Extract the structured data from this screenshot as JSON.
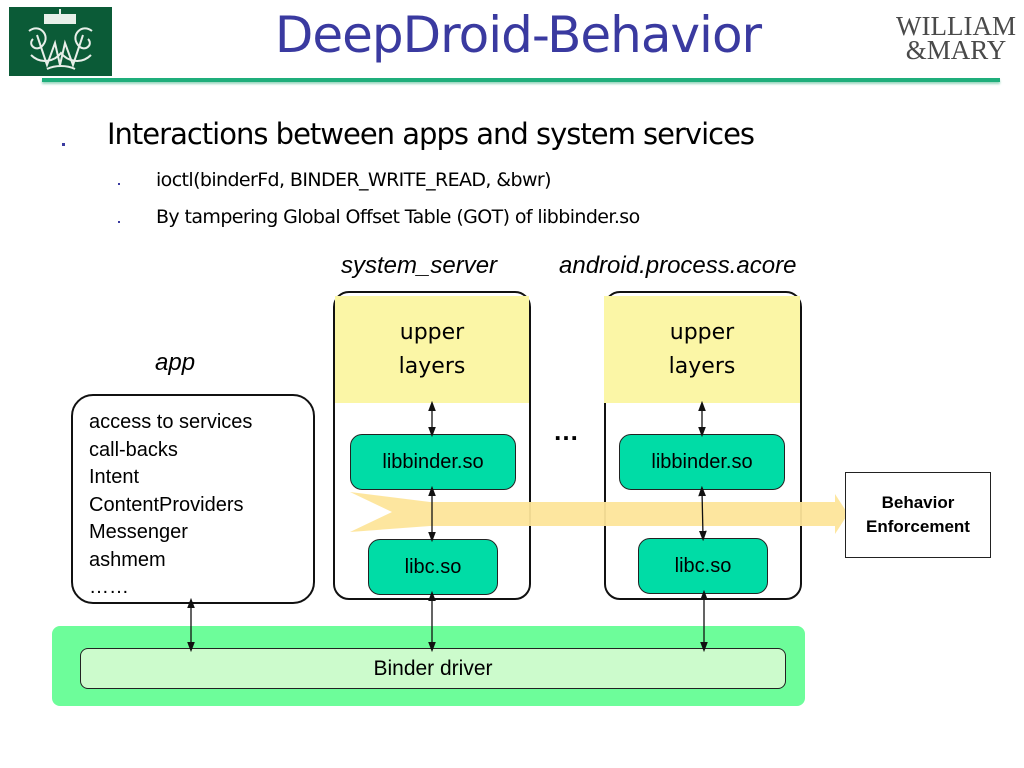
{
  "header": {
    "title": "DeepDroid-Behavior",
    "logo_left": "william-and-mary-cypher-logo",
    "logo_right": {
      "line1": "WILLIAM",
      "line2": "&MARY"
    },
    "colors": {
      "title": "#3a3aa0",
      "rule": "#1fae7b",
      "logo_bg": "#0b5b37"
    }
  },
  "bullets": {
    "main": "Interactions between apps and system services",
    "subs": [
      "ioctl(binderFd, BINDER_WRITE_READ, &bwr)",
      "By tampering Global Offset Table (GOT) of libbinder.so"
    ]
  },
  "diagram": {
    "app": {
      "label": "app",
      "items": [
        "access to services",
        "call-backs",
        "Intent",
        "ContentProviders",
        "Messenger",
        "ashmem",
        "……"
      ]
    },
    "processes": [
      {
        "label": "system_server",
        "upper": [
          "upper",
          "layers"
        ],
        "libbinder": "libbinder.so",
        "libc": "libc.so"
      },
      {
        "label": "android.process.acore",
        "upper": [
          "upper",
          "layers"
        ],
        "libbinder": "libbinder.so",
        "libc": "libc.so"
      }
    ],
    "ellipsis": "…",
    "enforcement": [
      "Behavior",
      "Enforcement"
    ],
    "binder_driver": "Binder driver",
    "colors": {
      "upper": "#fbf6a6",
      "lib": "#00dca6",
      "binder_outer": "#6dfd9a",
      "binder_inner": "#ccfbcc",
      "arrow": "#fde59a"
    }
  }
}
